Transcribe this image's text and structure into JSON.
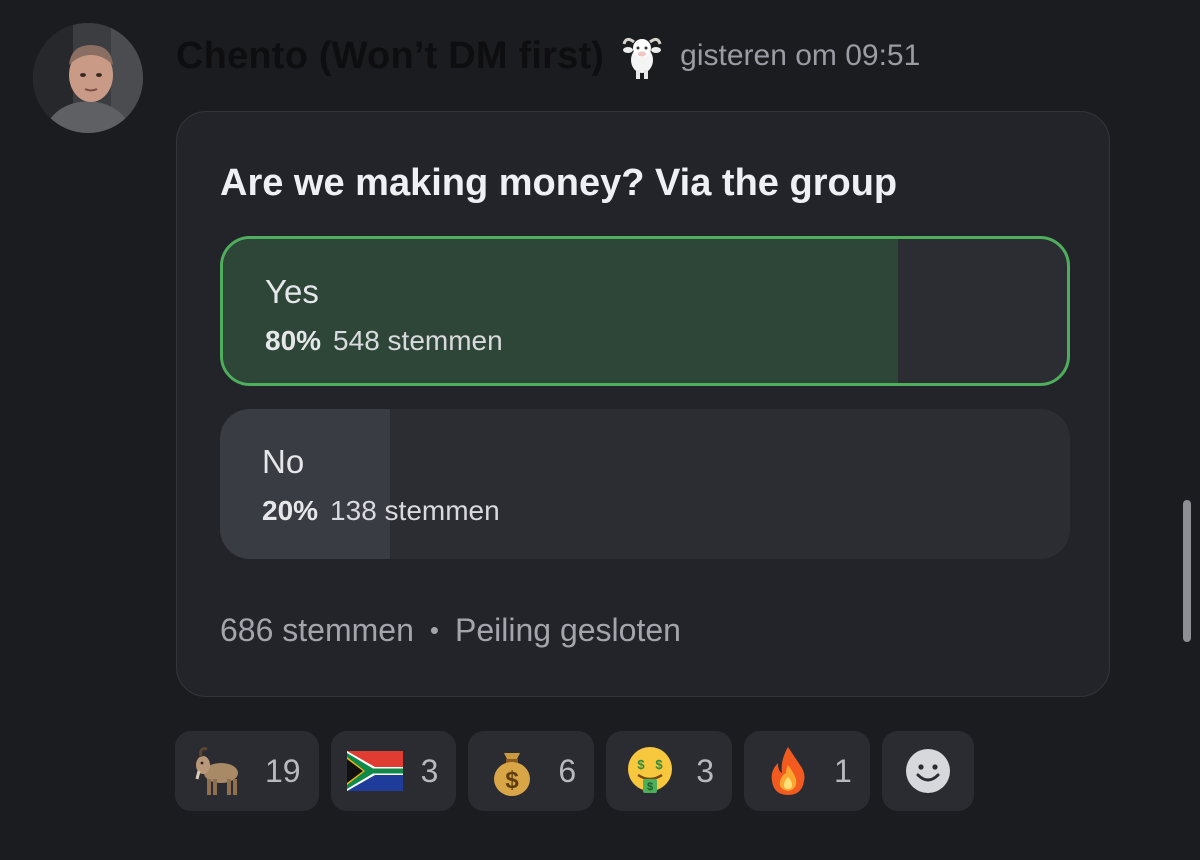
{
  "message": {
    "username": "Chento (Won’t DM first)",
    "badge_icon": "goat-icon",
    "timestamp": "gisteren om 09:51"
  },
  "poll": {
    "question": "Are we making money? Via the group",
    "answers": [
      {
        "label": "Yes",
        "percent_text": "80%",
        "votes_text": "548 stemmen",
        "percent": 80,
        "winner": true
      },
      {
        "label": "No",
        "percent_text": "20%",
        "votes_text": "138 stemmen",
        "percent": 20,
        "winner": false
      }
    ],
    "total_votes": "686 stemmen",
    "separator": "•",
    "status": "Peiling gesloten"
  },
  "reactions": [
    {
      "emoji": "goat-icon",
      "count": "19"
    },
    {
      "emoji": "south-africa-flag-icon",
      "count": "3"
    },
    {
      "emoji": "money-bag-icon",
      "count": "6"
    },
    {
      "emoji": "money-mouth-face-icon",
      "count": "3"
    },
    {
      "emoji": "fire-icon",
      "count": "1"
    }
  ],
  "add_reaction_icon": "smiley-add-reaction-icon",
  "colors": {
    "background": "#1b1c20",
    "card": "#232429",
    "winner_border": "#4fae5c",
    "winner_fill": "#2e4637"
  }
}
